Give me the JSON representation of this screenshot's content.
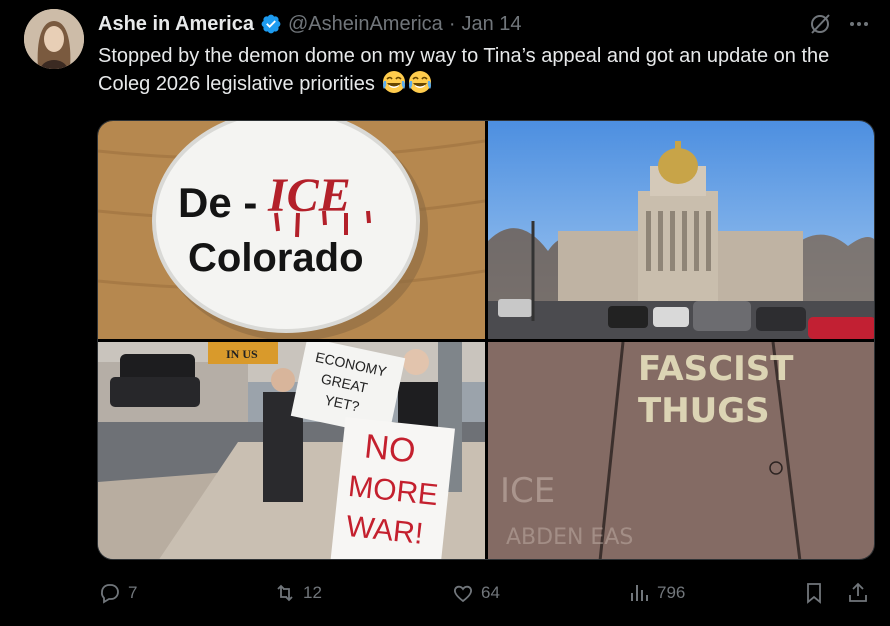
{
  "tweet": {
    "display_name": "Ashe in America",
    "handle": "@AsheinAmerica",
    "separator": "·",
    "date": "Jan 14",
    "text": "Stopped by the demon dome on my way to Tina’s appeal and got an update on the Coleg 2026 legislative priorities",
    "emojis": [
      "face-with-tears-of-joy",
      "face-with-tears-of-joy"
    ]
  },
  "media": {
    "button": {
      "line1": "De -",
      "ice": "ICE",
      "line2": "Colorado"
    },
    "sign_banner": "IN US",
    "sign_economy": [
      "ECONOMY",
      "GREAT",
      "YET?"
    ],
    "sign_war": [
      "NO",
      "MORE",
      "WAR!"
    ],
    "chalk_main": [
      "FASCIST",
      "THUGS"
    ],
    "chalk_faint": [
      "ICE",
      "ABDEN EAS"
    ]
  },
  "actions": {
    "replies": "7",
    "reposts": "12",
    "likes": "64",
    "views": "796"
  },
  "colors": {
    "background": "#000000",
    "text": "#e7e9ea",
    "muted": "#71767b",
    "verified": "#1d9bf0"
  },
  "icons": [
    "verified-badge-icon",
    "grok-icon",
    "more-icon",
    "reply-icon",
    "repost-icon",
    "like-icon",
    "views-icon",
    "bookmark-icon",
    "share-icon"
  ]
}
